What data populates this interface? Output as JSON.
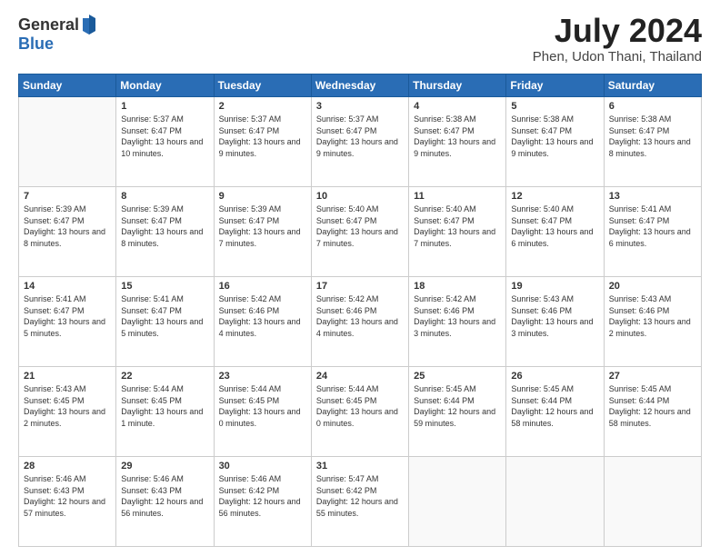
{
  "header": {
    "logo_line1": "General",
    "logo_line2": "Blue",
    "month_title": "July 2024",
    "location": "Phen, Udon Thani, Thailand"
  },
  "weekdays": [
    "Sunday",
    "Monday",
    "Tuesday",
    "Wednesday",
    "Thursday",
    "Friday",
    "Saturday"
  ],
  "weeks": [
    [
      {
        "day": "",
        "empty": true
      },
      {
        "day": "1",
        "sunrise": "Sunrise: 5:37 AM",
        "sunset": "Sunset: 6:47 PM",
        "daylight": "Daylight: 13 hours and 10 minutes."
      },
      {
        "day": "2",
        "sunrise": "Sunrise: 5:37 AM",
        "sunset": "Sunset: 6:47 PM",
        "daylight": "Daylight: 13 hours and 9 minutes."
      },
      {
        "day": "3",
        "sunrise": "Sunrise: 5:37 AM",
        "sunset": "Sunset: 6:47 PM",
        "daylight": "Daylight: 13 hours and 9 minutes."
      },
      {
        "day": "4",
        "sunrise": "Sunrise: 5:38 AM",
        "sunset": "Sunset: 6:47 PM",
        "daylight": "Daylight: 13 hours and 9 minutes."
      },
      {
        "day": "5",
        "sunrise": "Sunrise: 5:38 AM",
        "sunset": "Sunset: 6:47 PM",
        "daylight": "Daylight: 13 hours and 9 minutes."
      },
      {
        "day": "6",
        "sunrise": "Sunrise: 5:38 AM",
        "sunset": "Sunset: 6:47 PM",
        "daylight": "Daylight: 13 hours and 8 minutes."
      }
    ],
    [
      {
        "day": "7",
        "sunrise": "Sunrise: 5:39 AM",
        "sunset": "Sunset: 6:47 PM",
        "daylight": "Daylight: 13 hours and 8 minutes."
      },
      {
        "day": "8",
        "sunrise": "Sunrise: 5:39 AM",
        "sunset": "Sunset: 6:47 PM",
        "daylight": "Daylight: 13 hours and 8 minutes."
      },
      {
        "day": "9",
        "sunrise": "Sunrise: 5:39 AM",
        "sunset": "Sunset: 6:47 PM",
        "daylight": "Daylight: 13 hours and 7 minutes."
      },
      {
        "day": "10",
        "sunrise": "Sunrise: 5:40 AM",
        "sunset": "Sunset: 6:47 PM",
        "daylight": "Daylight: 13 hours and 7 minutes."
      },
      {
        "day": "11",
        "sunrise": "Sunrise: 5:40 AM",
        "sunset": "Sunset: 6:47 PM",
        "daylight": "Daylight: 13 hours and 7 minutes."
      },
      {
        "day": "12",
        "sunrise": "Sunrise: 5:40 AM",
        "sunset": "Sunset: 6:47 PM",
        "daylight": "Daylight: 13 hours and 6 minutes."
      },
      {
        "day": "13",
        "sunrise": "Sunrise: 5:41 AM",
        "sunset": "Sunset: 6:47 PM",
        "daylight": "Daylight: 13 hours and 6 minutes."
      }
    ],
    [
      {
        "day": "14",
        "sunrise": "Sunrise: 5:41 AM",
        "sunset": "Sunset: 6:47 PM",
        "daylight": "Daylight: 13 hours and 5 minutes."
      },
      {
        "day": "15",
        "sunrise": "Sunrise: 5:41 AM",
        "sunset": "Sunset: 6:47 PM",
        "daylight": "Daylight: 13 hours and 5 minutes."
      },
      {
        "day": "16",
        "sunrise": "Sunrise: 5:42 AM",
        "sunset": "Sunset: 6:46 PM",
        "daylight": "Daylight: 13 hours and 4 minutes."
      },
      {
        "day": "17",
        "sunrise": "Sunrise: 5:42 AM",
        "sunset": "Sunset: 6:46 PM",
        "daylight": "Daylight: 13 hours and 4 minutes."
      },
      {
        "day": "18",
        "sunrise": "Sunrise: 5:42 AM",
        "sunset": "Sunset: 6:46 PM",
        "daylight": "Daylight: 13 hours and 3 minutes."
      },
      {
        "day": "19",
        "sunrise": "Sunrise: 5:43 AM",
        "sunset": "Sunset: 6:46 PM",
        "daylight": "Daylight: 13 hours and 3 minutes."
      },
      {
        "day": "20",
        "sunrise": "Sunrise: 5:43 AM",
        "sunset": "Sunset: 6:46 PM",
        "daylight": "Daylight: 13 hours and 2 minutes."
      }
    ],
    [
      {
        "day": "21",
        "sunrise": "Sunrise: 5:43 AM",
        "sunset": "Sunset: 6:45 PM",
        "daylight": "Daylight: 13 hours and 2 minutes."
      },
      {
        "day": "22",
        "sunrise": "Sunrise: 5:44 AM",
        "sunset": "Sunset: 6:45 PM",
        "daylight": "Daylight: 13 hours and 1 minute."
      },
      {
        "day": "23",
        "sunrise": "Sunrise: 5:44 AM",
        "sunset": "Sunset: 6:45 PM",
        "daylight": "Daylight: 13 hours and 0 minutes."
      },
      {
        "day": "24",
        "sunrise": "Sunrise: 5:44 AM",
        "sunset": "Sunset: 6:45 PM",
        "daylight": "Daylight: 13 hours and 0 minutes."
      },
      {
        "day": "25",
        "sunrise": "Sunrise: 5:45 AM",
        "sunset": "Sunset: 6:44 PM",
        "daylight": "Daylight: 12 hours and 59 minutes."
      },
      {
        "day": "26",
        "sunrise": "Sunrise: 5:45 AM",
        "sunset": "Sunset: 6:44 PM",
        "daylight": "Daylight: 12 hours and 58 minutes."
      },
      {
        "day": "27",
        "sunrise": "Sunrise: 5:45 AM",
        "sunset": "Sunset: 6:44 PM",
        "daylight": "Daylight: 12 hours and 58 minutes."
      }
    ],
    [
      {
        "day": "28",
        "sunrise": "Sunrise: 5:46 AM",
        "sunset": "Sunset: 6:43 PM",
        "daylight": "Daylight: 12 hours and 57 minutes."
      },
      {
        "day": "29",
        "sunrise": "Sunrise: 5:46 AM",
        "sunset": "Sunset: 6:43 PM",
        "daylight": "Daylight: 12 hours and 56 minutes."
      },
      {
        "day": "30",
        "sunrise": "Sunrise: 5:46 AM",
        "sunset": "Sunset: 6:42 PM",
        "daylight": "Daylight: 12 hours and 56 minutes."
      },
      {
        "day": "31",
        "sunrise": "Sunrise: 5:47 AM",
        "sunset": "Sunset: 6:42 PM",
        "daylight": "Daylight: 12 hours and 55 minutes."
      },
      {
        "day": "",
        "empty": true
      },
      {
        "day": "",
        "empty": true
      },
      {
        "day": "",
        "empty": true
      }
    ]
  ]
}
